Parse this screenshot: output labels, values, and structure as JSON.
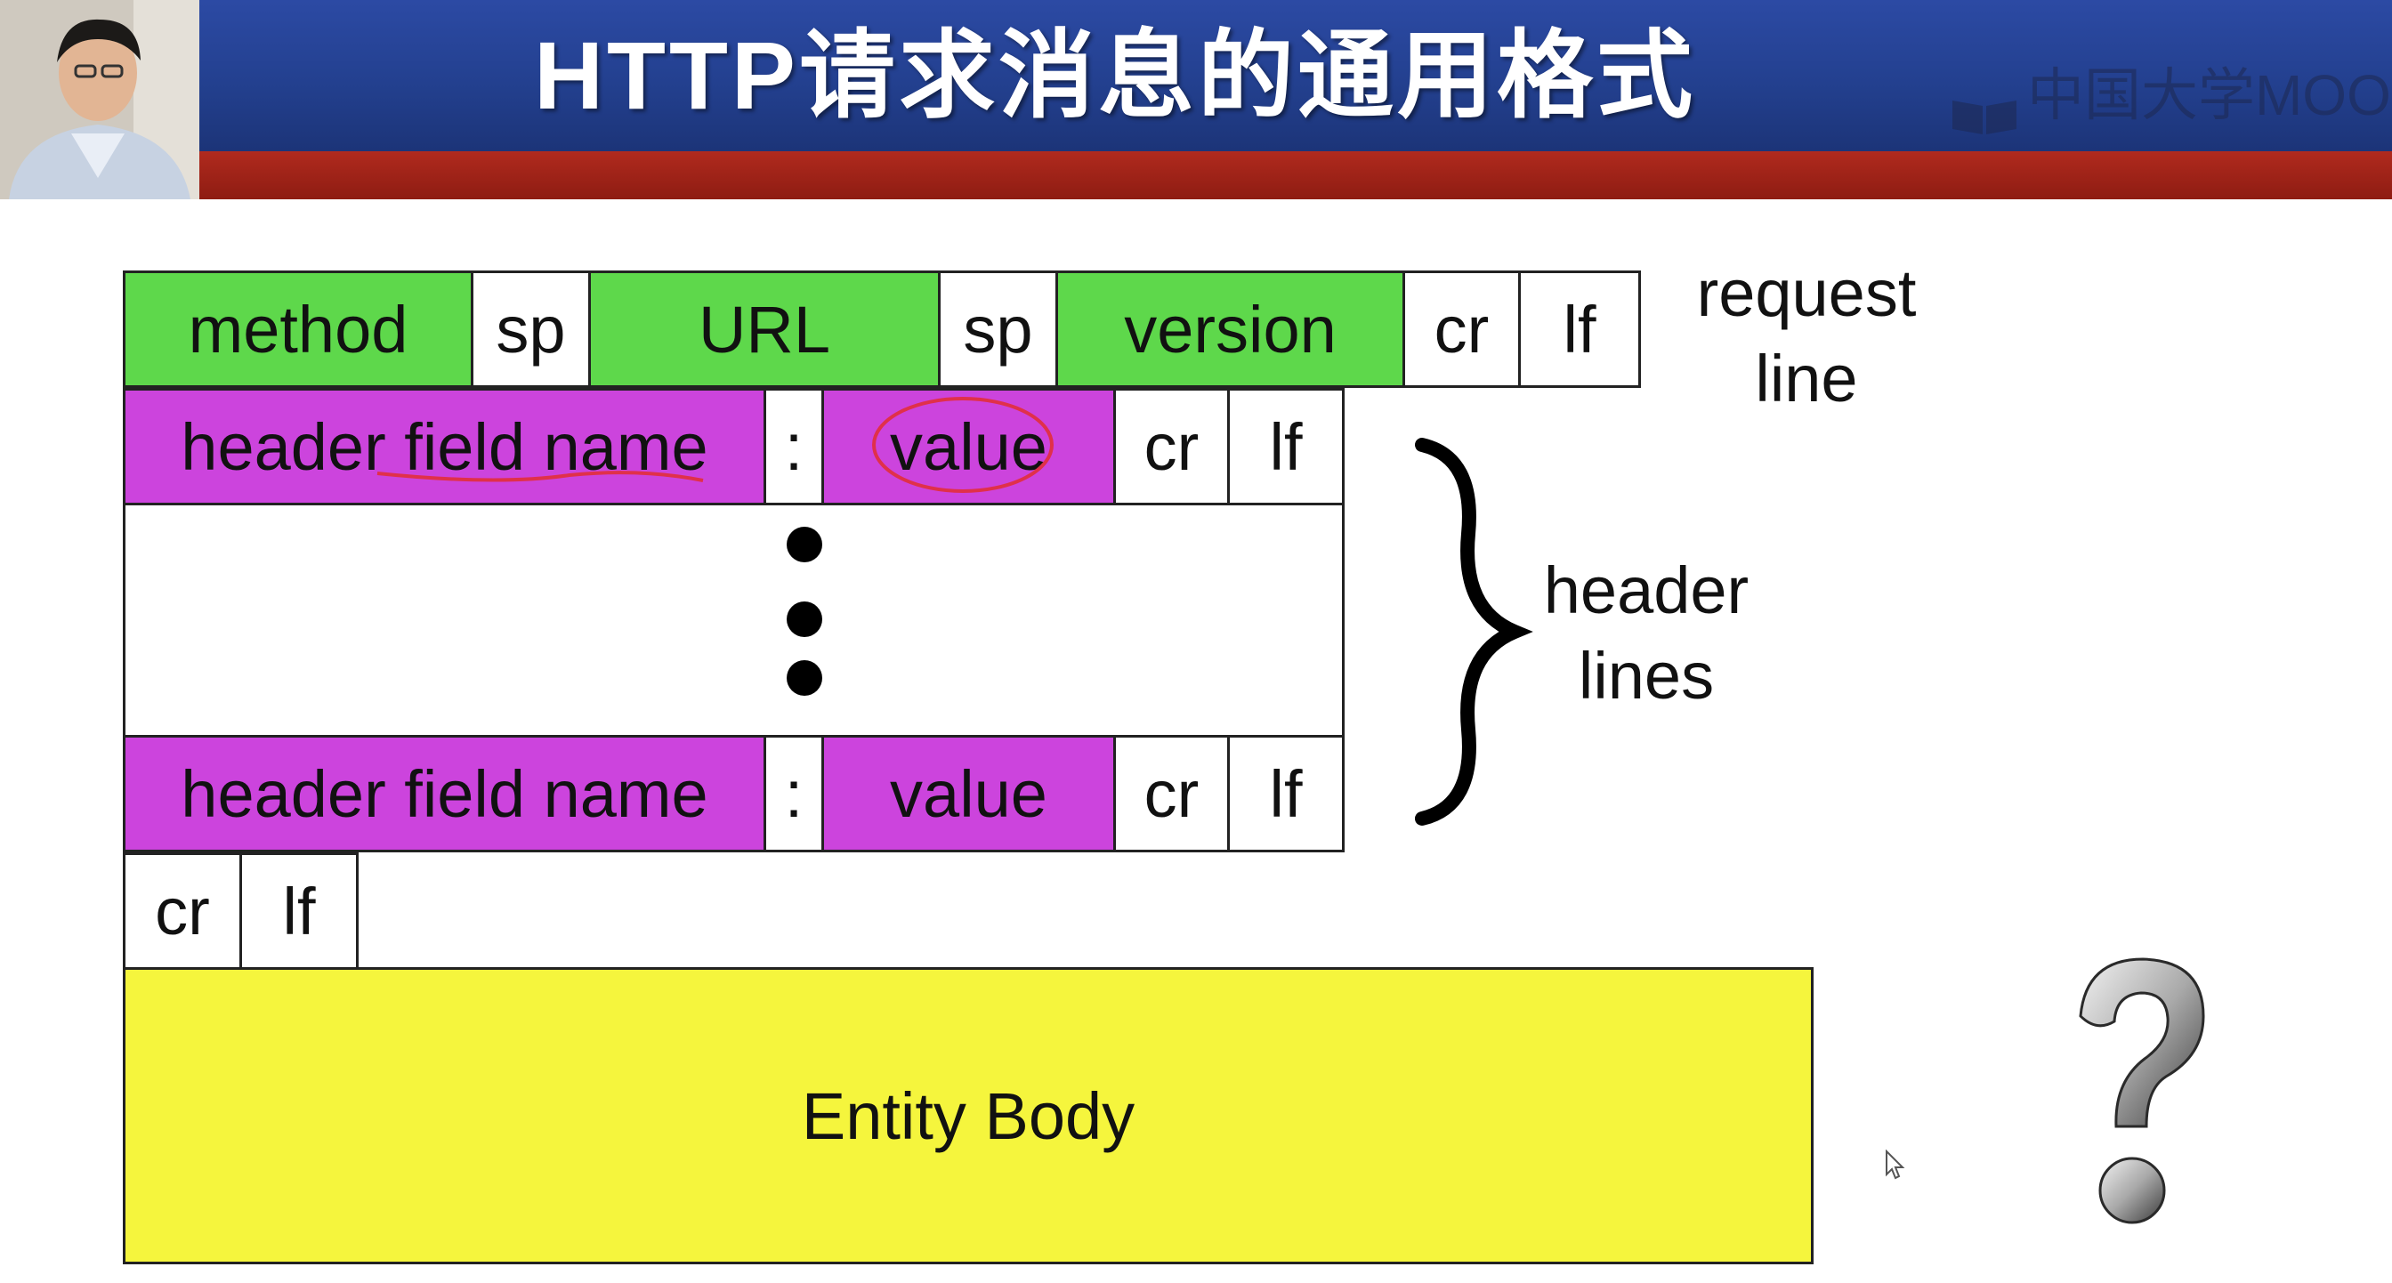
{
  "slide": {
    "title": "HTTP请求消息的通用格式",
    "watermark": "中国大学MOOC"
  },
  "request_line": {
    "cells": [
      "method",
      "sp",
      "URL",
      "sp",
      "version",
      "cr",
      "lf"
    ],
    "label_line1": "request",
    "label_line2": "line"
  },
  "header_line_1": {
    "name": "header field name",
    "colon": ":",
    "value": "value",
    "cr": "cr",
    "lf": "lf"
  },
  "header_line_n": {
    "name": "header field name",
    "colon": ":",
    "value": "value",
    "cr": "cr",
    "lf": "lf"
  },
  "header_lines_label": {
    "line1": "header",
    "line2": "lines"
  },
  "blank_line": {
    "cr": "cr",
    "lf": "lf"
  },
  "entity_body": "Entity Body",
  "colors": {
    "request_line": "#5ed84b",
    "header_line": "#cc44dd",
    "entity_body": "#f5f53d",
    "banner_blue": "#23408f",
    "banner_red": "#8e1c12",
    "annotation": "#e0304a"
  },
  "icons": [
    "question-mark-icon",
    "mouse-pointer-icon",
    "mooc-logo-icon"
  ]
}
